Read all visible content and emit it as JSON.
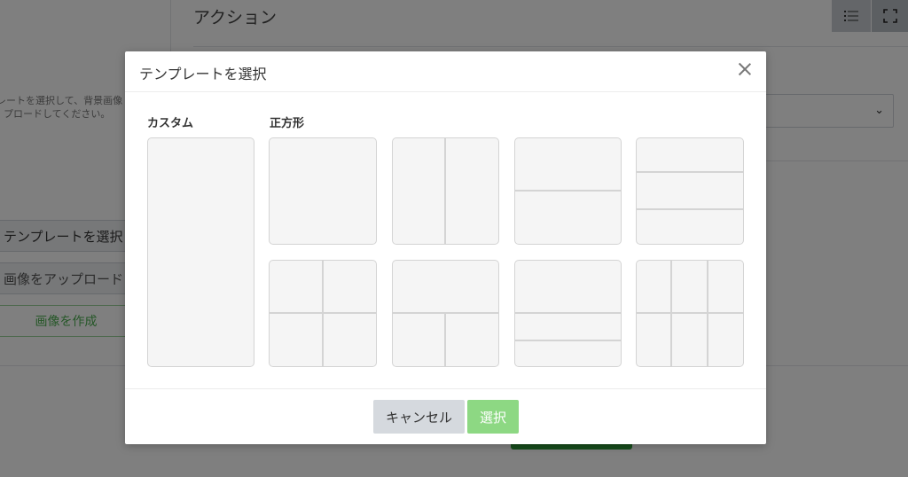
{
  "background": {
    "title": "アクション",
    "hint_line1": "レートを選択して、背景画像",
    "hint_line2": "プロードしてください。",
    "buttons": {
      "select_template": "テンプレートを選択",
      "upload_image": "画像をアップロード",
      "create_image": "画像を作成"
    },
    "icons": [
      "list-icon",
      "fullscreen-icon",
      "chevron-down-icon"
    ]
  },
  "modal": {
    "title": "テンプレートを選択",
    "sections": {
      "custom": "カスタム",
      "square": "正方形"
    },
    "templates": [
      "custom-tall",
      "square-1",
      "square-2-vertical",
      "square-2-horizontal",
      "square-3-rows",
      "square-4-grid",
      "square-1-top-2-bottom",
      "square-1-top-2-rows-bottom",
      "square-3-top-3-bottom"
    ],
    "footer": {
      "cancel": "キャンセル",
      "select": "選択"
    }
  },
  "colors": {
    "overlay": "rgba(0,0,0,0.5)",
    "accent_green": "#8dd883",
    "cancel_gray": "#d5d9de",
    "tile_fill": "#f5f5f5",
    "tile_border": "#d4d4d4"
  }
}
